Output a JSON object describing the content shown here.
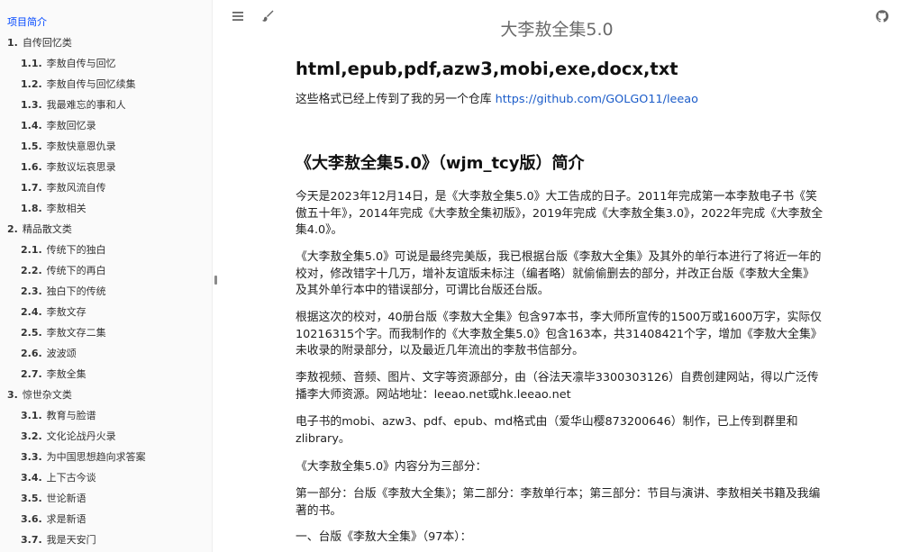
{
  "header": {
    "title": "大李敖全集5.0"
  },
  "sidebar": {
    "items": [
      {
        "type": "home",
        "num": "",
        "label": "项目简介",
        "active": true
      },
      {
        "type": "chapter",
        "num": "1.",
        "label": "自传回忆类"
      },
      {
        "type": "section",
        "num": "1.1.",
        "label": "李敖自传与回忆"
      },
      {
        "type": "section",
        "num": "1.2.",
        "label": "李敖自传与回忆续集"
      },
      {
        "type": "section",
        "num": "1.3.",
        "label": "我最难忘的事和人"
      },
      {
        "type": "section",
        "num": "1.4.",
        "label": "李敖回忆录"
      },
      {
        "type": "section",
        "num": "1.5.",
        "label": "李敖快意恩仇录"
      },
      {
        "type": "section",
        "num": "1.6.",
        "label": "李敖议坛哀思录"
      },
      {
        "type": "section",
        "num": "1.7.",
        "label": "李敖风流自传"
      },
      {
        "type": "section",
        "num": "1.8.",
        "label": "李敖相关"
      },
      {
        "type": "chapter",
        "num": "2.",
        "label": "精品散文类"
      },
      {
        "type": "section",
        "num": "2.1.",
        "label": "传统下的独白"
      },
      {
        "type": "section",
        "num": "2.2.",
        "label": "传统下的再白"
      },
      {
        "type": "section",
        "num": "2.3.",
        "label": "独白下的传统"
      },
      {
        "type": "section",
        "num": "2.4.",
        "label": "李敖文存"
      },
      {
        "type": "section",
        "num": "2.5.",
        "label": "李敖文存二集"
      },
      {
        "type": "section",
        "num": "2.6.",
        "label": "波波颂"
      },
      {
        "type": "section",
        "num": "2.7.",
        "label": "李敖全集"
      },
      {
        "type": "chapter",
        "num": "3.",
        "label": "惊世杂文类"
      },
      {
        "type": "section",
        "num": "3.1.",
        "label": "教育与脸谱"
      },
      {
        "type": "section",
        "num": "3.2.",
        "label": "文化论战丹火录"
      },
      {
        "type": "section",
        "num": "3.3.",
        "label": "为中国思想趋向求答案"
      },
      {
        "type": "section",
        "num": "3.4.",
        "label": "上下古今谈"
      },
      {
        "type": "section",
        "num": "3.5.",
        "label": "世论新语"
      },
      {
        "type": "section",
        "num": "3.6.",
        "label": "求是新语"
      },
      {
        "type": "section",
        "num": "3.7.",
        "label": "我是天安门"
      }
    ]
  },
  "content": {
    "h1": "html,epub,pdf,azw3,mobi,exe,docx,txt",
    "repo_text": "这些格式已经上传到了我的另一个仓库 ",
    "repo_link": "https://github.com/GOLGO11/leeao",
    "h2": "《大李敖全集5.0》（wjm_tcy版）简介",
    "p1": "今天是2023年12月14日，是《大李敖全集5.0》大工告成的日子。2011年完成第一本李敖电子书《笑傲五十年》，2014年完成《大李敖全集初版》，2019年完成《大李敖全集3.0》，2022年完成《大李敖全集4.0》。",
    "p2": "《大李敖全集5.0》可说是最终完美版，我已根据台版《李敖大全集》及其外的单行本进行了将近一年的校对，修改错字十几万，增补友谊版未标注（编者略）就偷偷删去的部分，并改正台版《李敖大全集》及其外单行本中的错误部分，可谓比台版还台版。",
    "p3": "根据这次的校对，40册台版《李敖大全集》包含97本书，李大师所宣传的1500万或1600万字，实际仅10216315个字。而我制作的《大李敖全集5.0》包含163本，共31408421个字，增加《李敖大全集》未收录的附录部分，以及最近几年流出的李敖书信部分。",
    "p4": "李敖视频、音频、图片、文字等资源部分，由（谷法天凛毕3300303126）自费创建网站，得以广泛传播李大师资源。网站地址：leeao.net或hk.leeao.net",
    "p5": "电子书的mobi、azw3、pdf、epub、md格式由（爱华山樱873200646）制作，已上传到群里和zlibrary。",
    "p6": "《大李敖全集5.0》内容分为三部分：",
    "p7": "第一部分：台版《李敖大全集》；第二部分：李敖单行本；第三部分：节目与演讲、李敖相关书籍及我编著的书。",
    "p8": "一、台版《李敖大全集》（97本）："
  }
}
